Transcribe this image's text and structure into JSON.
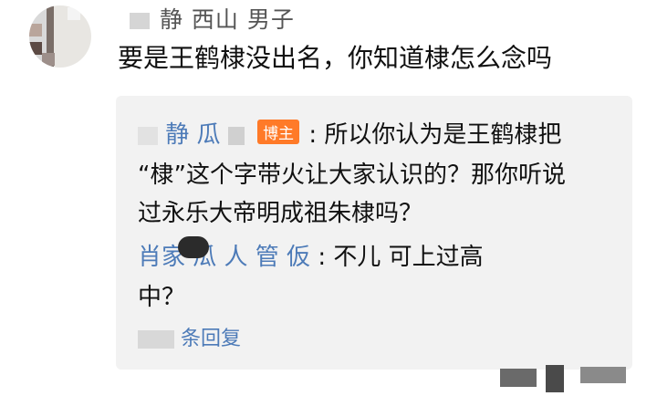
{
  "comment": {
    "username": "静 西山 男子",
    "text": "要是王鹤棣没出名，你知道棣怎么念吗"
  },
  "replies": [
    {
      "name": "静 瓜",
      "badge": "博主",
      "lines": [
        ": 所以你认为是王鹤棣把",
        "“棣”这个字带火让大家认识的？那你听说",
        "过永乐大帝明成祖朱棣吗？"
      ]
    },
    {
      "name": "肖家 瓜 人 管 仮",
      "lines": [
        ": 不儿 可上过高",
        "中？"
      ]
    }
  ],
  "reply_more_label": "条回复"
}
